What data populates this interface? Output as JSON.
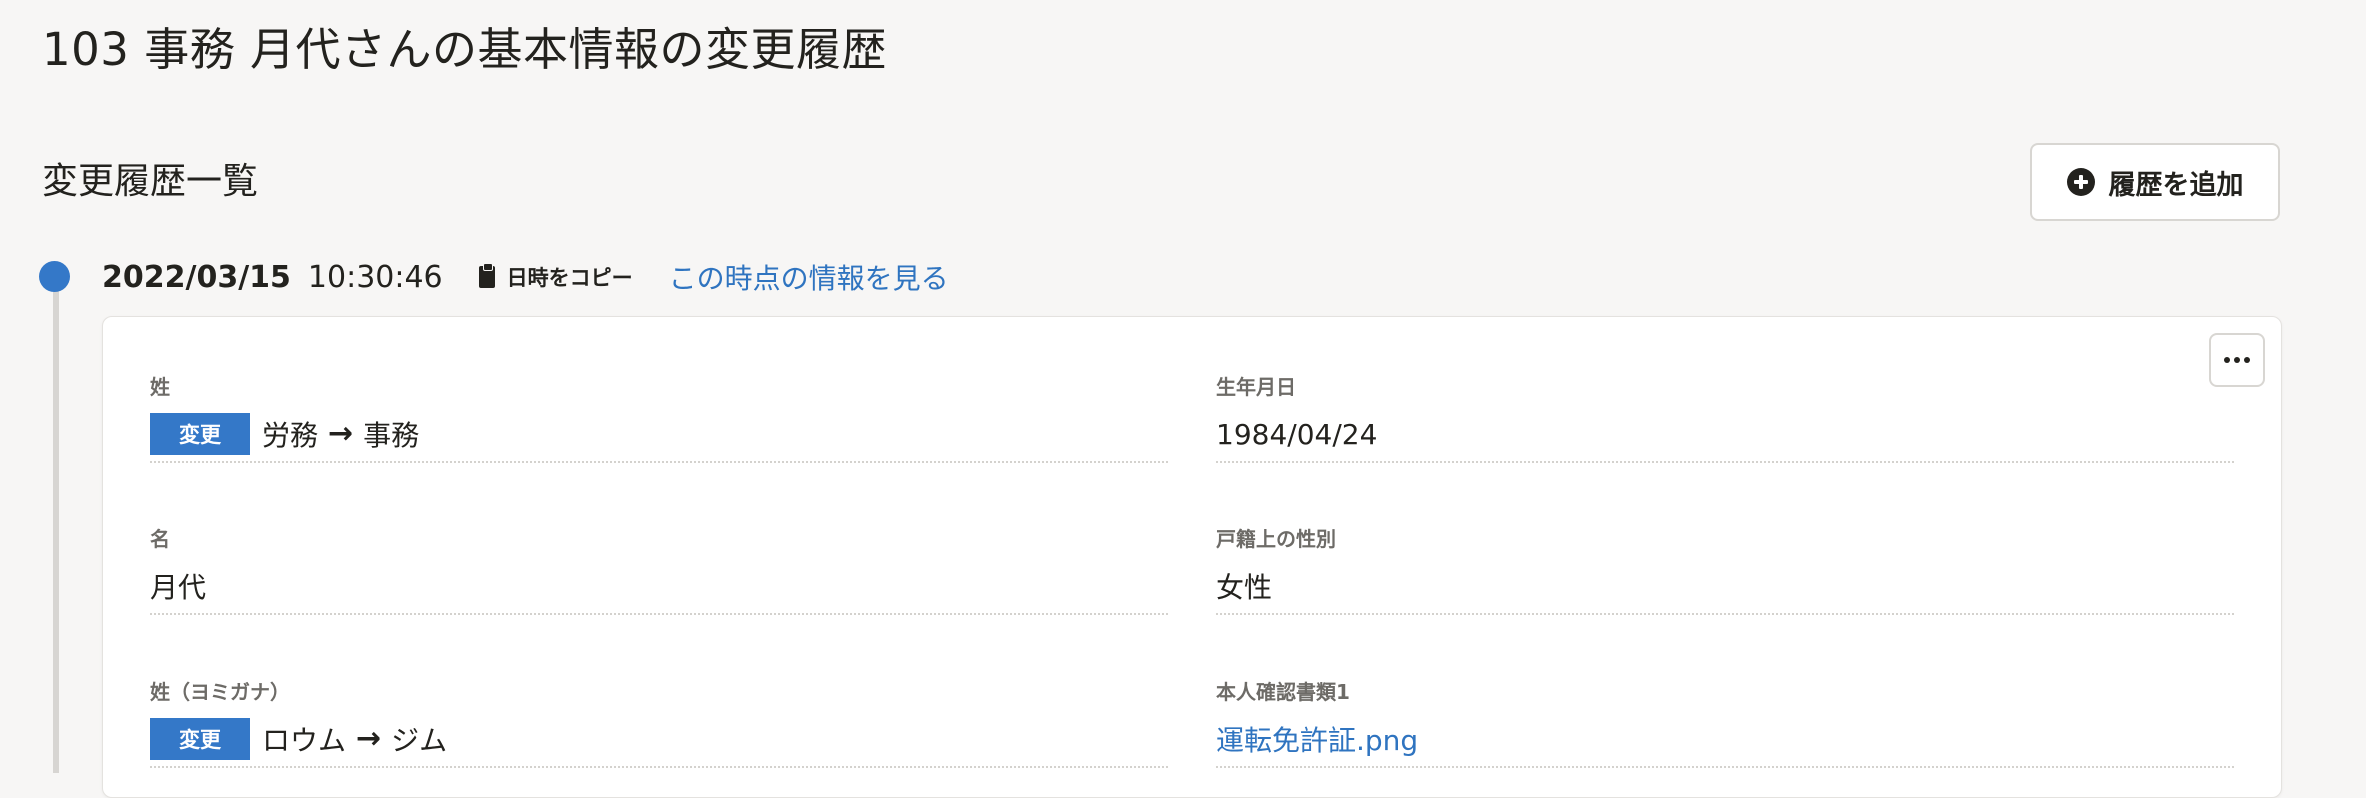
{
  "page": {
    "title": "103 事務 月代さんの基本情報の変更履歴"
  },
  "history": {
    "title": "変更履歴一覧",
    "add_label": "履歴を追加"
  },
  "entry": {
    "date": "2022/03/15",
    "time": "10:30:46",
    "copy_label": "日時をコピー",
    "view_link": "この時点の情報を見る",
    "fields": {
      "last_name": {
        "label": "姓",
        "badge": "変更",
        "before": "労務",
        "after": "事務"
      },
      "birthdate": {
        "label": "生年月日",
        "value": "1984/04/24"
      },
      "first_name": {
        "label": "名",
        "value": "月代"
      },
      "gender": {
        "label": "戸籍上の性別",
        "value": "女性"
      },
      "last_name_kana": {
        "label": "姓（ヨミガナ）",
        "badge": "変更",
        "before": "ロウム",
        "after": "ジム"
      },
      "id_document": {
        "label": "本人確認書類1",
        "value": "運転免許証.png"
      }
    }
  },
  "colors": {
    "accent": "#3478c8",
    "link": "#2f74c0",
    "background": "#f7f6f5"
  },
  "icons": {
    "add": "plus-circle-icon",
    "copy": "clipboard-icon",
    "menu": "ellipsis-icon",
    "arrow": "arrow-right-icon"
  }
}
